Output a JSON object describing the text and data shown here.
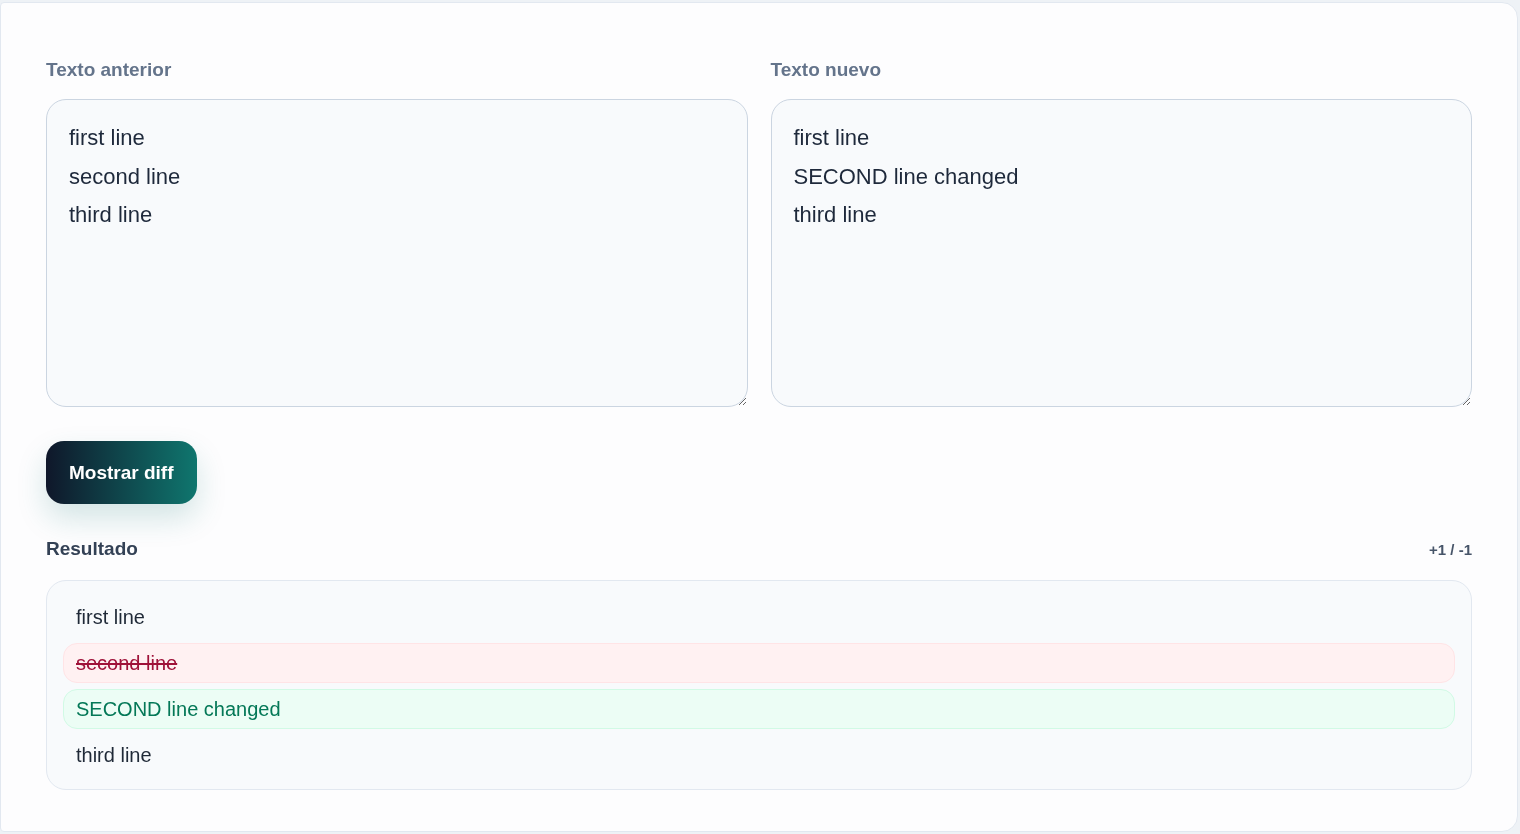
{
  "editors": [
    {
      "label": "Texto anterior",
      "value": "first line\nsecond line\nthird line"
    },
    {
      "label": "Texto nuevo",
      "value": "first line\nSECOND line changed\nthird line"
    }
  ],
  "action_button": {
    "label": "Mostrar diff"
  },
  "result": {
    "title": "Resultado",
    "summary": "+1 / -1",
    "lines": [
      {
        "kind": "same",
        "text": "first line"
      },
      {
        "kind": "removed",
        "text": "second line"
      },
      {
        "kind": "added",
        "text": "SECOND line changed"
      },
      {
        "kind": "same",
        "text": "third line"
      }
    ]
  }
}
